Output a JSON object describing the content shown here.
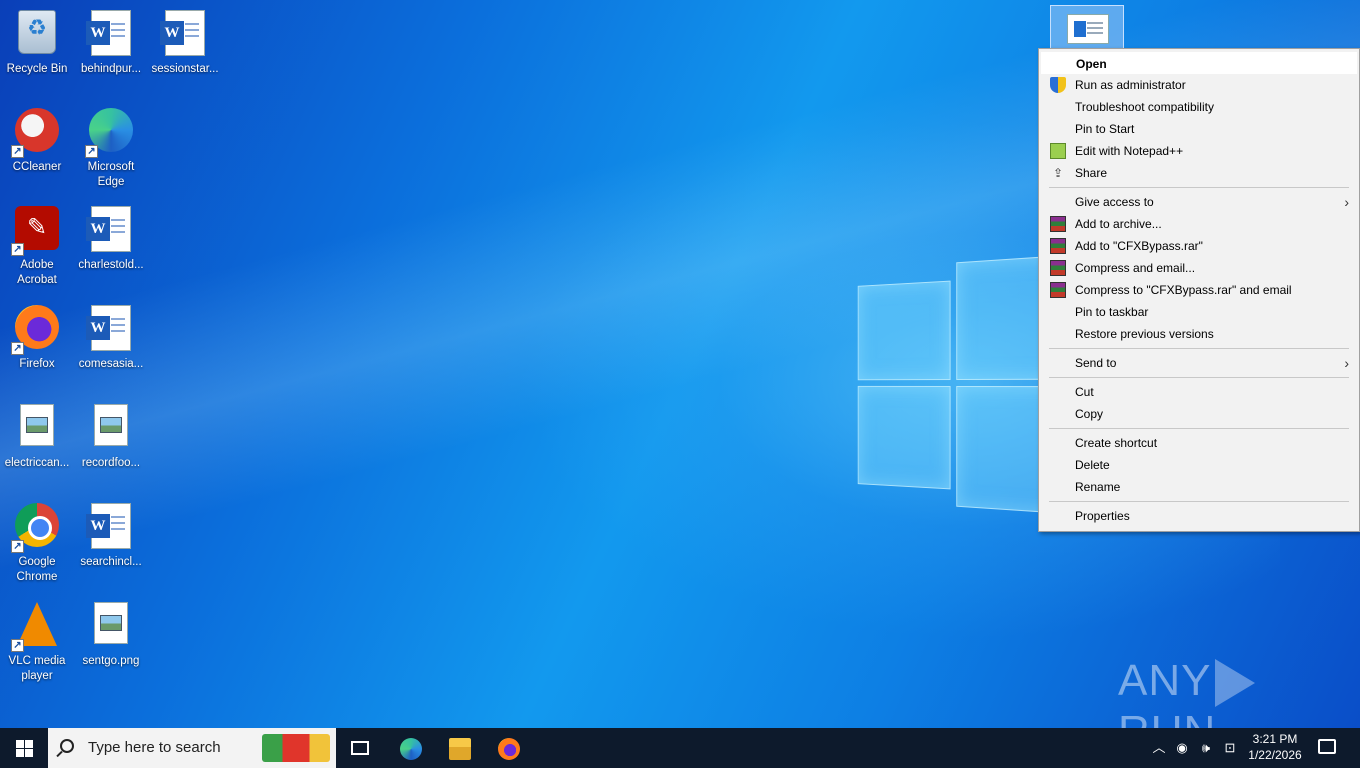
{
  "desktop": {
    "icons": [
      {
        "label": "Recycle Bin"
      },
      {
        "label": "behindpur..."
      },
      {
        "label": "sessionstar..."
      },
      {
        "label": "CCleaner"
      },
      {
        "label": "Microsoft Edge"
      },
      {
        "label": "Adobe Acrobat"
      },
      {
        "label": "charlestold..."
      },
      {
        "label": "Firefox"
      },
      {
        "label": "comesasia..."
      },
      {
        "label": "electriccan..."
      },
      {
        "label": "recordfoo..."
      },
      {
        "label": "Google Chrome"
      },
      {
        "label": "searchincl..."
      },
      {
        "label": "VLC media player"
      },
      {
        "label": "sentgo.png"
      }
    ]
  },
  "context_menu": {
    "items": [
      {
        "label": "Open",
        "icon": ""
      },
      {
        "label": "Run as administrator",
        "icon": "shield-icon"
      },
      {
        "label": "Troubleshoot compatibility",
        "icon": ""
      },
      {
        "label": "Pin to Start",
        "icon": ""
      },
      {
        "label": "Edit with Notepad++",
        "icon": "notepad-icon"
      },
      {
        "label": "Share",
        "icon": "share-icon"
      },
      {
        "label": "Give access to",
        "icon": ""
      },
      {
        "label": "Add to archive...",
        "icon": "winrar-icon"
      },
      {
        "label": "Add to \"CFXBypass.rar\"",
        "icon": "winrar-icon"
      },
      {
        "label": "Compress and email...",
        "icon": "winrar-icon"
      },
      {
        "label": "Compress to \"CFXBypass.rar\" and email",
        "icon": "winrar-icon"
      },
      {
        "label": "Pin to taskbar",
        "icon": ""
      },
      {
        "label": "Restore previous versions",
        "icon": ""
      },
      {
        "label": "Send to",
        "icon": ""
      },
      {
        "label": "Cut",
        "icon": ""
      },
      {
        "label": "Copy",
        "icon": ""
      },
      {
        "label": "Create shortcut",
        "icon": ""
      },
      {
        "label": "Delete",
        "icon": ""
      },
      {
        "label": "Rename",
        "icon": ""
      },
      {
        "label": "Properties",
        "icon": ""
      }
    ]
  },
  "watermark": {
    "left": "ANY",
    "right": "RUN"
  },
  "taskbar": {
    "search_placeholder": "Type here to search",
    "time": "3:21 PM",
    "date": "1/22/2026"
  }
}
